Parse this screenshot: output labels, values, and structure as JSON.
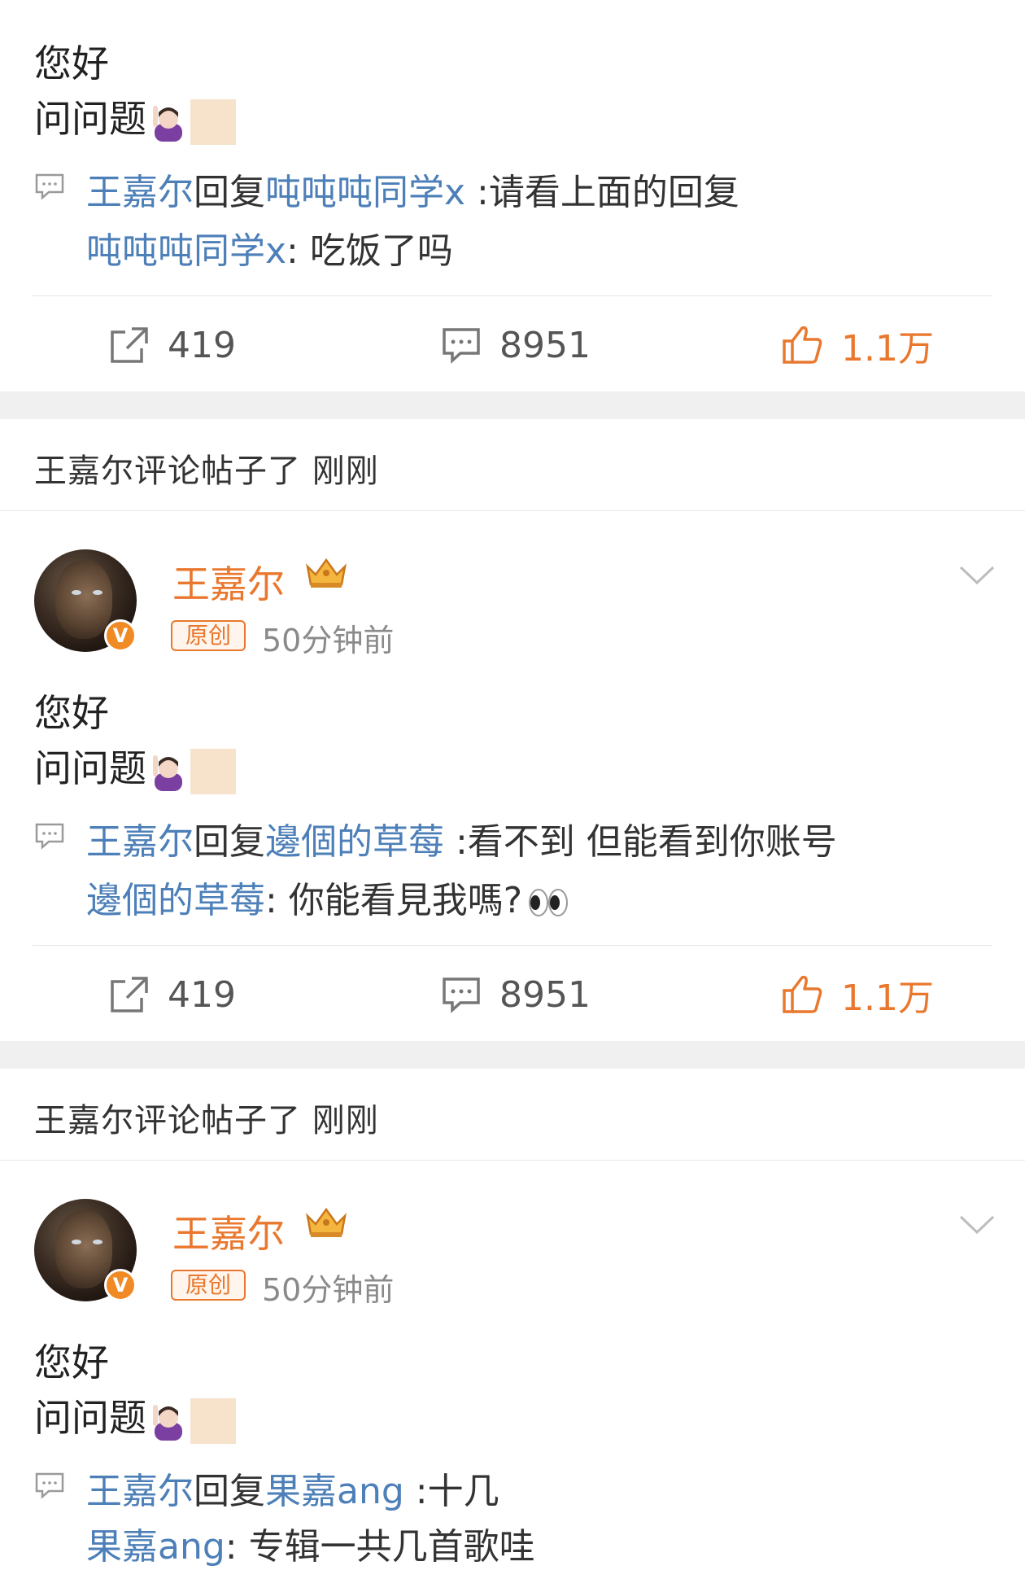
{
  "posts": [
    {
      "body_line1": "您好",
      "body_line2": "问问题",
      "reply": {
        "author": "王嘉尔",
        "verb": "回复",
        "target": "吨吨吨同学x",
        "text": " :请看上面的回复",
        "quoted_author": "吨吨吨同学x",
        "quoted_text": ": 吃饭了吗",
        "quoted_emoji": ""
      },
      "actions": {
        "share": "419",
        "comment": "8951",
        "like": "1.1万"
      }
    },
    {
      "notice": "王嘉尔评论帖子了 刚刚",
      "author": "王嘉尔",
      "badge": "原创",
      "time": "50分钟前",
      "body_line1": "您好",
      "body_line2": "问问题",
      "reply": {
        "author": "王嘉尔",
        "verb": "回复",
        "target": "邊個的草莓",
        "text": " :看不到 但能看到你账号",
        "quoted_author": "邊個的草莓",
        "quoted_text": ": 你能看見我嗎?",
        "quoted_emoji": "eyes"
      },
      "actions": {
        "share": "419",
        "comment": "8951",
        "like": "1.1万"
      }
    },
    {
      "notice": "王嘉尔评论帖子了 刚刚",
      "author": "王嘉尔",
      "badge": "原创",
      "time": "50分钟前",
      "body_line1": "您好",
      "body_line2": "问问题",
      "reply": {
        "author": "王嘉尔",
        "verb": "回复",
        "target": "果嘉ang",
        "text": " :十几",
        "quoted_author": "果嘉ang",
        "quoted_text": ": 专辑一共几首歌哇",
        "quoted_emoji": ""
      }
    }
  ],
  "colors": {
    "accent": "#e9782e",
    "link": "#4d7fb8",
    "band": "#f0f0f0"
  },
  "icons": [
    "share-icon",
    "comment-icon",
    "like-icon",
    "chevron-down-icon",
    "crown-icon",
    "verified-icon",
    "reply-comment-icon"
  ]
}
